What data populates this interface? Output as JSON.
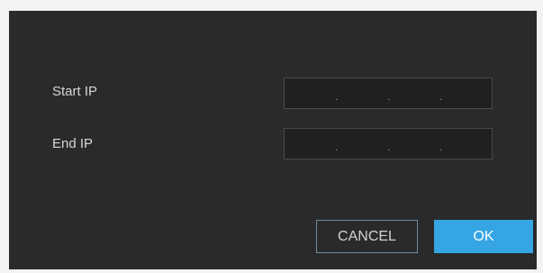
{
  "dialog": {
    "start_ip_label": "Start IP",
    "end_ip_label": "End IP",
    "start_ip": {
      "dots": [
        ".",
        ".",
        "."
      ]
    },
    "end_ip": {
      "dots": [
        ".",
        ".",
        "."
      ]
    },
    "cancel_label": "CANCEL",
    "ok_label": "OK"
  },
  "colors": {
    "background": "#2a2a2a",
    "accent": "#35a6e3"
  }
}
